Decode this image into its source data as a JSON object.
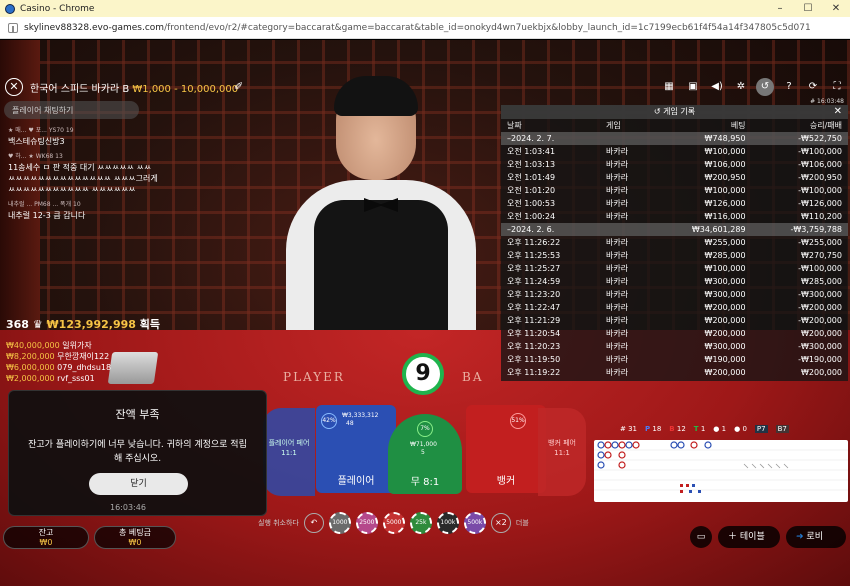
{
  "window": {
    "title": "Casino - Chrome",
    "min": "–",
    "max": "☐",
    "close": "✕"
  },
  "url": {
    "host": "skylinev88328.evo-games.com",
    "path": "/frontend/evo/r2/#category=baccarat&game=baccarat&table_id=onokyd4wn7uekbjx&lobby_launch_id=1c7199ecb61f4f54a14f347805c5d071"
  },
  "game": {
    "title": "한국어 스피드 바카라 B",
    "limit": "₩1,000 - 10,000,000"
  },
  "chat": {
    "placeholder": "플레이어 채팅하기",
    "messages": [
      {
        "meta": "★ 매...   ♥ 포... YS70  19",
        "text": "백스테슈팅신방3"
      },
      {
        "meta": "♥ 하...  ★ WK68  13",
        "text": "11송세수 ㅁ 판 적중 대기 ㅆㅆㅆㅆㅆ ㅆㅆㅆㅆㅆㅆㅆㅆㅆㅆㅆㅆㅆㅆㅆㅆ ㅆㅆㅆ그러게 ㅆㅆㅆㅆㅆㅆㅆㅆㅆㅆㅆ ㅆㅆㅆㅆㅆㅆ"
      },
      {
        "meta": "내추럴 ... PM68 ... 폭개  10",
        "text": "내추럴 12-3 큼 갑니다"
      }
    ]
  },
  "winners": {
    "count": "368",
    "total": "₩123,992,998",
    "suffix": "획득",
    "list": [
      {
        "amount": "₩40,000,000",
        "name": "일위가자"
      },
      {
        "amount": "₩8,200,000",
        "name": "무한깡재이122"
      },
      {
        "amount": "₩6,000,000",
        "name": "079_dhdsu18"
      },
      {
        "amount": "₩2,000,000",
        "name": "rvf_sss01"
      }
    ]
  },
  "timer": "9",
  "felt": {
    "player": "PLAYER",
    "banker": "BA"
  },
  "clock": "# 16:03:48",
  "history": {
    "title": "게임 기록",
    "columns": [
      "날짜",
      "게임",
      "베팅",
      "승리/패배"
    ],
    "rows": [
      {
        "date": true,
        "c1": "–2024. 2. 7.",
        "c2": "",
        "c3": "₩748,950",
        "c4": "-₩522,750"
      },
      {
        "c1": "오전 1:03:41",
        "c2": "바카라",
        "c3": "₩100,000",
        "c4": "-₩100,000"
      },
      {
        "c1": "오전 1:03:13",
        "c2": "바카라",
        "c3": "₩106,000",
        "c4": "-₩106,000"
      },
      {
        "c1": "오전 1:01:49",
        "c2": "바카라",
        "c3": "₩200,950",
        "c4": "-₩200,950"
      },
      {
        "c1": "오전 1:01:20",
        "c2": "바카라",
        "c3": "₩100,000",
        "c4": "-₩100,000"
      },
      {
        "c1": "오전 1:00:53",
        "c2": "바카라",
        "c3": "₩126,000",
        "c4": "-₩126,000"
      },
      {
        "c1": "오전 1:00:24",
        "c2": "바카라",
        "c3": "₩116,000",
        "c4": "₩110,200"
      },
      {
        "date": true,
        "c1": "–2024. 2. 6.",
        "c2": "",
        "c3": "₩34,601,289",
        "c4": "-₩3,759,788"
      },
      {
        "c1": "오후 11:26:22",
        "c2": "바카라",
        "c3": "₩255,000",
        "c4": "-₩255,000"
      },
      {
        "c1": "오후 11:25:53",
        "c2": "바카라",
        "c3": "₩285,000",
        "c4": "₩270,750"
      },
      {
        "c1": "오후 11:25:27",
        "c2": "바카라",
        "c3": "₩100,000",
        "c4": "-₩100,000"
      },
      {
        "c1": "오후 11:24:59",
        "c2": "바카라",
        "c3": "₩300,000",
        "c4": "₩285,000"
      },
      {
        "c1": "오후 11:23:20",
        "c2": "바카라",
        "c3": "₩300,000",
        "c4": "-₩300,000"
      },
      {
        "c1": "오후 11:22:47",
        "c2": "바카라",
        "c3": "₩200,000",
        "c4": "-₩200,000"
      },
      {
        "c1": "오후 11:21:29",
        "c2": "바카라",
        "c3": "₩200,000",
        "c4": "-₩200,000"
      },
      {
        "c1": "오후 11:20:54",
        "c2": "바카라",
        "c3": "₩200,000",
        "c4": "₩200,000"
      },
      {
        "c1": "오후 11:20:23",
        "c2": "바카라",
        "c3": "₩300,000",
        "c4": "-₩300,000"
      },
      {
        "c1": "오후 11:19:50",
        "c2": "바카라",
        "c3": "₩190,000",
        "c4": "-₩190,000"
      },
      {
        "c1": "오후 11:19:22",
        "c2": "바카라",
        "c3": "₩200,000",
        "c4": "₩200,000"
      }
    ]
  },
  "bets": {
    "player_pair": "플레이어 페어",
    "player_pair_odds": "11:1",
    "player": "플레이어",
    "player_pct": "42%",
    "player_amt": "₩3,333,312",
    "player_count": "48",
    "tie": "무 8:1",
    "tie_pct": "7%",
    "tie_amt": "₩71,000",
    "tie_count": "5",
    "banker": "뱅커",
    "banker_pct": "51%",
    "banker_pair": "뱅커 페어",
    "banker_pair_odds": "11:1"
  },
  "road": {
    "total": "# 31",
    "p": "18",
    "b": "12",
    "t": "1",
    "pp": "1",
    "bp": "0",
    "p7": "P7",
    "b7": "B7"
  },
  "dialog": {
    "title": "잔액 부족",
    "message": "잔고가 플레이하기에 너무 낮습니다. 귀하의 계정으로 적립해 주십시오.",
    "button": "닫기"
  },
  "bottom": {
    "time": "16:03:46",
    "balance_label": "잔고",
    "balance": "₩0",
    "total_bet_label": "총 베팅금",
    "total_bet": "₩0",
    "undo_label": "실행 취소하다",
    "chips": [
      "1000",
      "2500",
      "5000",
      "25k",
      "100k",
      "500k"
    ],
    "double": "×2",
    "double_label": "더블",
    "tables": "테이블",
    "lobby": "로비"
  },
  "colors": {
    "accent": "#f6c445",
    "player": "#2b4fb3",
    "banker": "#c21f1f",
    "tie": "#1f8f43"
  }
}
